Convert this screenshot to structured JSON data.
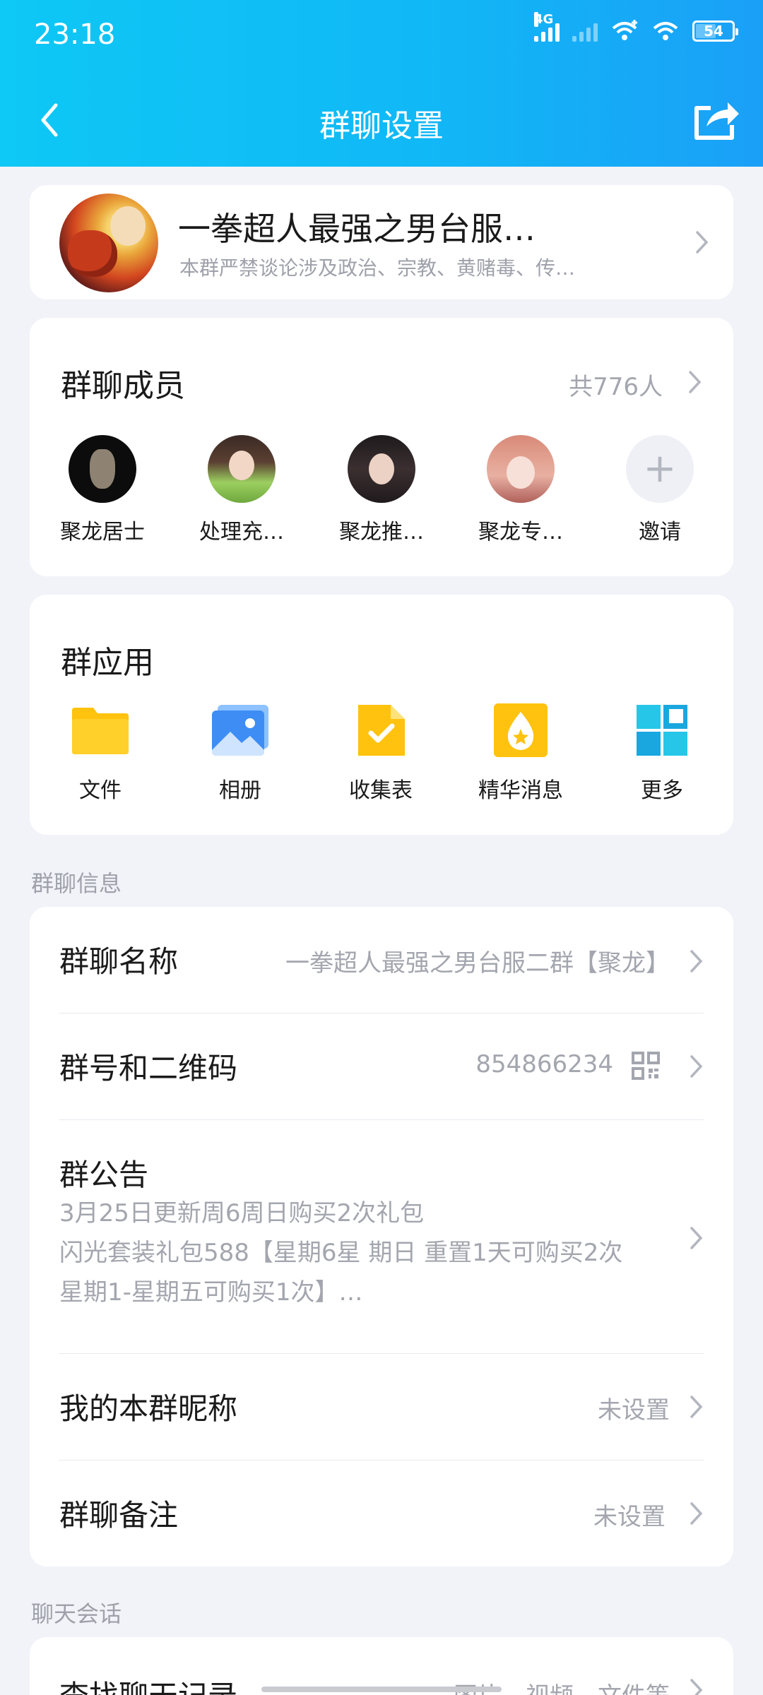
{
  "status_bar": {
    "time": "23:18",
    "network": "4G",
    "battery": "54"
  },
  "nav": {
    "title": "群聊设置"
  },
  "group": {
    "name": "一拳超人最强之男台服…",
    "description": "本群严禁谈论涉及政治、宗教、黄赌毒、传…"
  },
  "members": {
    "title": "群聊成员",
    "count": "共776人",
    "list": [
      {
        "name": "聚龙居士"
      },
      {
        "name": "处理充…"
      },
      {
        "name": "聚龙推…"
      },
      {
        "name": "聚龙专…"
      }
    ],
    "invite_label": "邀请"
  },
  "apps": {
    "title": "群应用",
    "items": [
      {
        "label": "文件",
        "icon": "folder-icon"
      },
      {
        "label": "相册",
        "icon": "photo-album-icon"
      },
      {
        "label": "收集表",
        "icon": "form-icon"
      },
      {
        "label": "精华消息",
        "icon": "essence-icon"
      },
      {
        "label": "更多",
        "icon": "grid-more-icon"
      }
    ]
  },
  "info_section": {
    "label": "群聊信息",
    "name_label": "群聊名称",
    "name_value": "一拳超人最强之男台服二群【聚龙】",
    "number_label": "群号和二维码",
    "number_value": "854866234",
    "notice_label": "群公告",
    "notice_lines": [
      "3月25日更新周6周日购买2次礼包",
      "闪光套装礼包588【星期6星 期日 重置1天可购买2次",
      "星期1-星期五可购买1次】…"
    ],
    "nickname_label": "我的本群昵称",
    "nickname_value": "未设置",
    "remark_label": "群聊备注",
    "remark_value": "未设置"
  },
  "chat_section": {
    "label": "聊天会话",
    "search_label": "查找聊天记录",
    "search_value": "图片、视频、文件等"
  },
  "colors": {
    "header_start": "#0ec8f5",
    "header_end": "#1aa0f7",
    "background": "#f2f3f8",
    "secondary_text": "#a3a6ae"
  }
}
